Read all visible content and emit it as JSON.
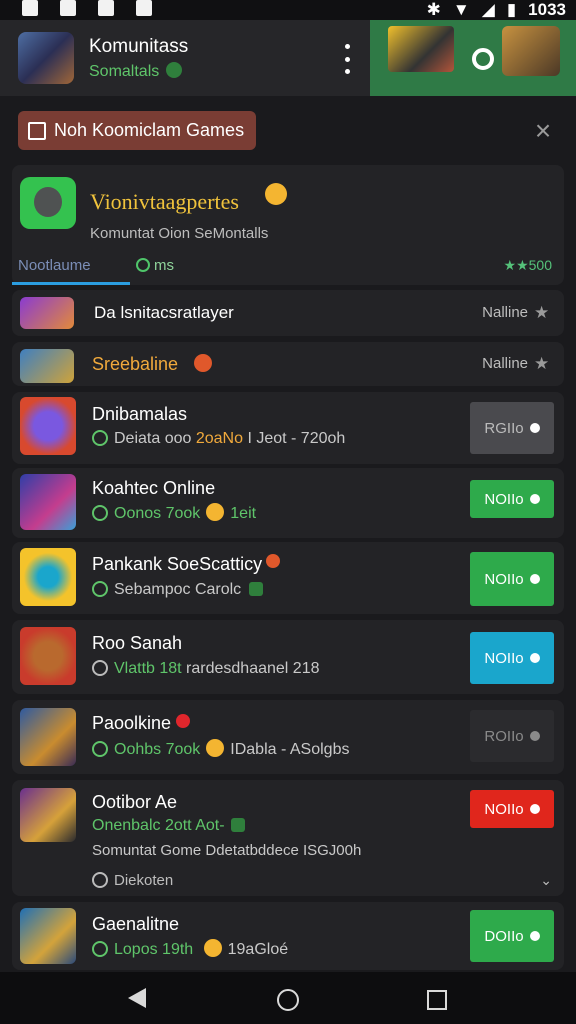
{
  "status_bar": {
    "time": "1033"
  },
  "header": {
    "title": "Komunitass",
    "subtitle": "Somaltals",
    "menu_icon": "kebab-icon"
  },
  "banner": {
    "chip_label": "Noh Koomiclam Games",
    "close": "×"
  },
  "featured": {
    "title": "Vionivtaagpertes",
    "description": "Komuntat Oion SeMontalls",
    "tab_primary": "Nootlaume",
    "tab_secondary": "ms",
    "rating": "★★500"
  },
  "games": [
    {
      "name": "Da lsnitacsratlayer",
      "status": "Nalline"
    },
    {
      "name": "Sreebaline",
      "status": "Nalline"
    },
    {
      "name": "Dnibamalas",
      "meta_a": "Deiata ooo ",
      "meta_b": "2oaNo",
      "meta_c": " I Jeot - 720oh",
      "button": "RGIIo",
      "button_color": "#4a4a4e"
    },
    {
      "name": "Koahtec Online",
      "meta_a": "Oonos 7ook",
      "meta_c": "1eit",
      "button": "NOIIo",
      "button_color": "#2eaa4b"
    },
    {
      "name": "Pankank SoeScatticy",
      "meta_a": "Sebampoc Carolc",
      "button": "NOIIo",
      "button_color": "#2eaa4b"
    },
    {
      "name": "Roo Sanah",
      "meta_a": "Vlattb 18t ",
      "meta_c": "rardesdhaanel  218",
      "button": "NOIIo",
      "button_color": "#1aa6cc"
    },
    {
      "name": "Paoolkine",
      "meta_a": "Oohbs 7ook",
      "meta_c": "IDabla - ASolgbs",
      "button": "ROIIo",
      "button_color": "#2b2b2e"
    },
    {
      "name": "Ootibor Ae",
      "meta_a": "Onenbalc 2ott Aot-",
      "meta_line2": "Somuntat Gome Ddetatbddece ISGJ00h",
      "expand_label": "Diekoten",
      "button": "NOIIo",
      "button_color": "#e0261c"
    },
    {
      "name": "Gaenalitne",
      "meta_a": "Lopos 19th ",
      "meta_c": "19aGloé",
      "button": "DOIIo",
      "button_color": "#2eaa4b"
    }
  ]
}
